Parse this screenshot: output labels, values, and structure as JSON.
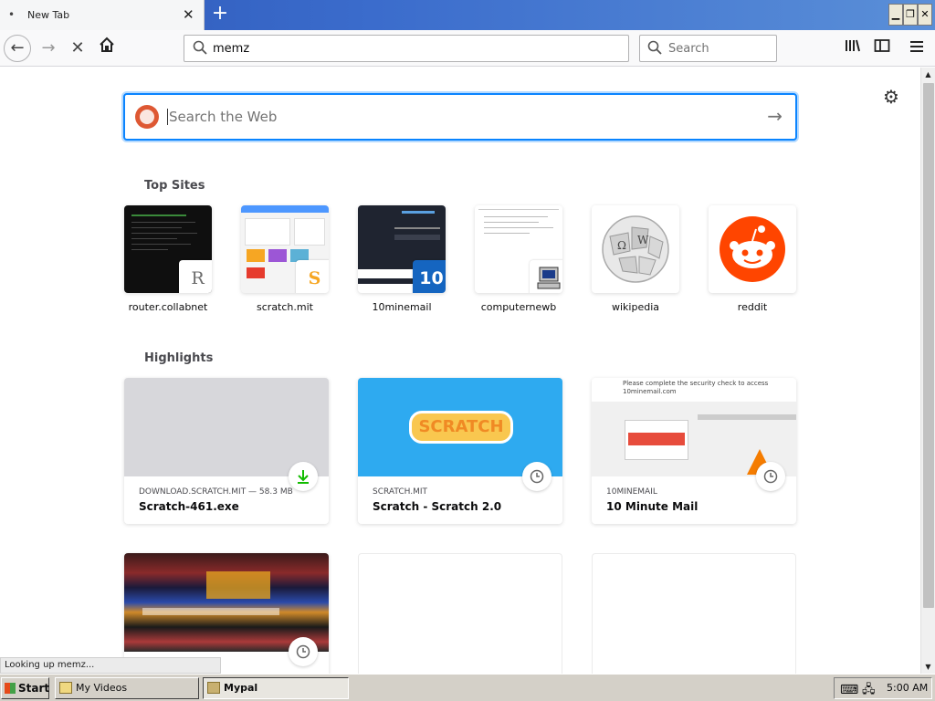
{
  "browser": {
    "tab_title": "New Tab",
    "url_value": "memz",
    "search_placeholder": "Search",
    "status_text": "Looking up memz..."
  },
  "newtab": {
    "websearch_placeholder": "Search the Web",
    "top_sites_title": "Top Sites",
    "highlights_title": "Highlights",
    "top_sites": [
      {
        "label": "router.collabnet",
        "badge": "R"
      },
      {
        "label": "scratch.mit",
        "badge": "S"
      },
      {
        "label": "10minemail",
        "badge": "10"
      },
      {
        "label": "computernewb",
        "badge": ""
      },
      {
        "label": "wikipedia",
        "badge": ""
      },
      {
        "label": "reddit",
        "badge": ""
      }
    ],
    "highlights": [
      {
        "meta": "DOWNLOAD.SCRATCH.MIT — 58.3 MB",
        "title": "Scratch-461.exe",
        "icon": "download-icon"
      },
      {
        "meta": "SCRATCH.MIT",
        "title": "Scratch - Scratch 2.0",
        "icon": "clock-icon"
      },
      {
        "meta": "10MINEMAIL",
        "title": "10 Minute Mail",
        "icon": "clock-icon"
      },
      {
        "meta": "",
        "title": "",
        "icon": "clock-icon"
      }
    ],
    "scratch_logo_text": "SCRATCH",
    "tenmin_preview_text": "Please complete the security check to access 10minemail.com"
  },
  "taskbar": {
    "start_label": "Start",
    "tasks": [
      "My Videos",
      "Mypal"
    ],
    "clock": "5:00 AM"
  },
  "colors": {
    "accent": "#0a84ff",
    "reddit": "#ff4500",
    "scratch": "#2eaaf0",
    "download_green": "#12bc00"
  }
}
